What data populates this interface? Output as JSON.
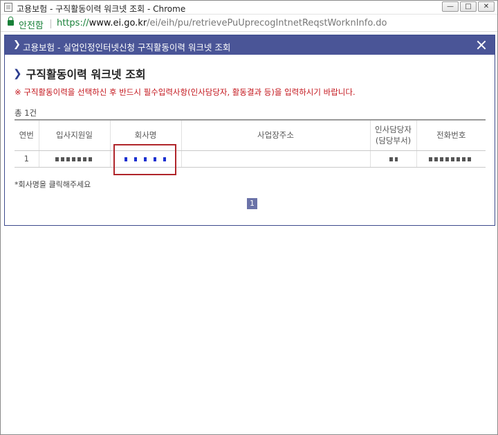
{
  "window": {
    "title": "고용보험 - 구직활동이력 워크넷 조회 - Chrome",
    "controls": {
      "minimize": "—",
      "restore": "□",
      "close": "✕"
    }
  },
  "address_bar": {
    "secure_label": "안전함",
    "url_scheme": "https://",
    "url_host": "www.ei.go.kr",
    "url_path": "/ei/eih/pu/retrievePuUprecogIntnetReqstWorknInfo.do"
  },
  "popup": {
    "header_title": "고용보험 - 실업인정인터넷신청 구직활동이력 워크넷 조회",
    "page_title": "구직활동이력 워크넷 조회",
    "notice": "※ 구직활동이력을 선택하신 후 반드시 필수입력사항(인사담당자, 활동결과 등)을 입력하시기 바랍니다.",
    "total": "총 1건",
    "hint": "*회사명을 클릭해주세요",
    "pagination": {
      "current": "1"
    }
  },
  "table": {
    "headers": {
      "seq": "연번",
      "apply_date": "입사지원일",
      "company": "회사명",
      "address": "사업장주소",
      "hr_manager_line1": "인사담당자",
      "hr_manager_line2": "(담당부서)",
      "phone": "전화번호"
    },
    "rows": [
      {
        "seq": "1",
        "apply_date": "",
        "company": "",
        "address": "",
        "hr_manager": "",
        "phone": ""
      }
    ]
  },
  "colors": {
    "header_bar": "#4a5597",
    "notice_text": "#c3141b",
    "secure_green": "#188038",
    "highlight_border": "#b0252a",
    "pager_bg": "#6a72a8"
  }
}
